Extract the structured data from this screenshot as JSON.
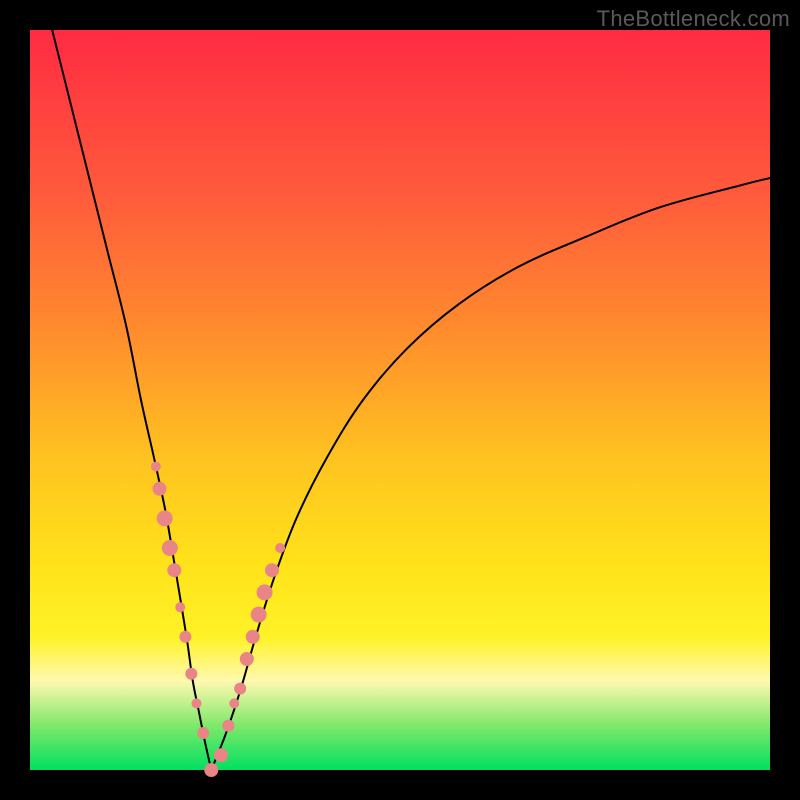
{
  "watermark": {
    "text": "TheBottleneck.com"
  },
  "chart_data": {
    "type": "line",
    "title": "",
    "xlabel": "",
    "ylabel": "",
    "xlim": [
      0,
      100
    ],
    "ylim": [
      0,
      100
    ],
    "background_gradient": {
      "direction": "top-to-bottom",
      "stops": [
        {
          "pos": 0,
          "color": "#ff2b42"
        },
        {
          "pos": 22,
          "color": "#ff5a3c"
        },
        {
          "pos": 40,
          "color": "#ff8a2e"
        },
        {
          "pos": 58,
          "color": "#ffc320"
        },
        {
          "pos": 72,
          "color": "#ffe21a"
        },
        {
          "pos": 82,
          "color": "#fff227"
        },
        {
          "pos": 88,
          "color": "#fff9b0"
        },
        {
          "pos": 94,
          "color": "#7fe86a"
        },
        {
          "pos": 100,
          "color": "#00e060"
        }
      ]
    },
    "series": [
      {
        "name": "left-branch",
        "stroke": "#000000",
        "stroke_width": 2,
        "x": [
          3.0,
          5.5,
          8.0,
          10.5,
          13.0,
          15.0,
          16.8,
          18.3,
          19.5,
          20.5,
          21.3,
          22.0,
          22.8,
          23.6,
          24.5
        ],
        "y": [
          100,
          90,
          80,
          70,
          60,
          50,
          42,
          35,
          28,
          22,
          17,
          12,
          8,
          4,
          0
        ]
      },
      {
        "name": "right-branch",
        "stroke": "#000000",
        "stroke_width": 2,
        "x": [
          24.5,
          26.5,
          28.5,
          30.5,
          33.0,
          36.0,
          40.0,
          45.0,
          51.0,
          58.0,
          66.0,
          75.0,
          85.0,
          96.0,
          100.0
        ],
        "y": [
          0,
          5,
          11,
          18,
          26,
          34,
          42,
          50,
          57,
          63,
          68,
          72,
          76,
          79,
          80
        ]
      }
    ],
    "markers": {
      "color": "#e98487",
      "size_small": 6,
      "size_large": 10,
      "points": [
        {
          "x": 17.0,
          "y": 41,
          "r": 5
        },
        {
          "x": 17.5,
          "y": 38,
          "r": 7
        },
        {
          "x": 18.2,
          "y": 34,
          "r": 8
        },
        {
          "x": 18.9,
          "y": 30,
          "r": 8
        },
        {
          "x": 19.5,
          "y": 27,
          "r": 7
        },
        {
          "x": 20.3,
          "y": 22,
          "r": 5
        },
        {
          "x": 21.0,
          "y": 18,
          "r": 6
        },
        {
          "x": 21.8,
          "y": 13,
          "r": 6
        },
        {
          "x": 22.5,
          "y": 9,
          "r": 5
        },
        {
          "x": 23.4,
          "y": 5,
          "r": 6
        },
        {
          "x": 24.5,
          "y": 0,
          "r": 7
        },
        {
          "x": 25.8,
          "y": 2,
          "r": 7
        },
        {
          "x": 26.8,
          "y": 6,
          "r": 6
        },
        {
          "x": 27.6,
          "y": 9,
          "r": 5
        },
        {
          "x": 28.4,
          "y": 11,
          "r": 6
        },
        {
          "x": 29.3,
          "y": 15,
          "r": 7
        },
        {
          "x": 30.1,
          "y": 18,
          "r": 7
        },
        {
          "x": 30.9,
          "y": 21,
          "r": 8
        },
        {
          "x": 31.7,
          "y": 24,
          "r": 8
        },
        {
          "x": 32.7,
          "y": 27,
          "r": 7
        },
        {
          "x": 33.8,
          "y": 30,
          "r": 5
        }
      ]
    }
  }
}
